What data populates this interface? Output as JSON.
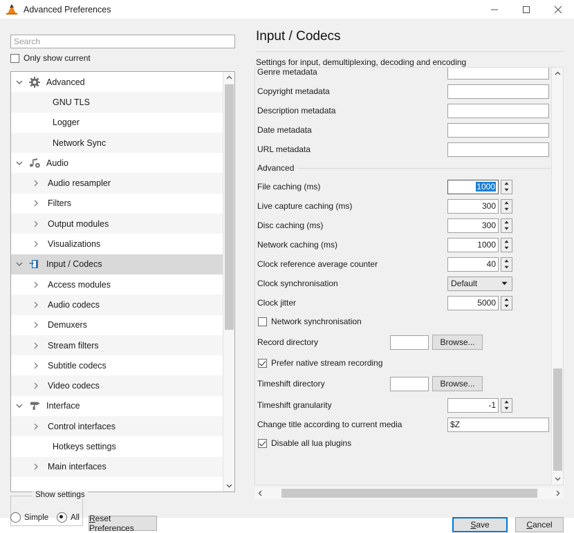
{
  "window": {
    "title": "Advanced Preferences",
    "app_icon": "vlc-cone-icon",
    "minimize": "minimize-icon",
    "maximize": "maximize-icon",
    "close": "close-icon"
  },
  "sidebar": {
    "search": {
      "value": "",
      "placeholder": "Search"
    },
    "only_show_current": {
      "label": "Only show current",
      "checked": false
    },
    "tree": [
      {
        "label": "Advanced",
        "level": 0,
        "expander": "down",
        "icon": "gear-icon",
        "alt": false,
        "selected": false
      },
      {
        "label": "GNU TLS",
        "level": 1,
        "expander": "none",
        "icon": "none",
        "alt": true,
        "selected": false
      },
      {
        "label": "Logger",
        "level": 1,
        "expander": "none",
        "icon": "none",
        "alt": false,
        "selected": false
      },
      {
        "label": "Network Sync",
        "level": 1,
        "expander": "none",
        "icon": "none",
        "alt": true,
        "selected": false
      },
      {
        "label": "Audio",
        "level": 0,
        "expander": "down",
        "icon": "audio-note-icon",
        "alt": false,
        "selected": false
      },
      {
        "label": "Audio resampler",
        "level": 1,
        "expander": "right",
        "icon": "none",
        "alt": true,
        "selected": false
      },
      {
        "label": "Filters",
        "level": 1,
        "expander": "right",
        "icon": "none",
        "alt": false,
        "selected": false
      },
      {
        "label": "Output modules",
        "level": 1,
        "expander": "right",
        "icon": "none",
        "alt": true,
        "selected": false
      },
      {
        "label": "Visualizations",
        "level": 1,
        "expander": "right",
        "icon": "none",
        "alt": false,
        "selected": false
      },
      {
        "label": "Input / Codecs",
        "level": 0,
        "expander": "down",
        "icon": "input-codecs-icon",
        "alt": false,
        "selected": true
      },
      {
        "label": "Access modules",
        "level": 1,
        "expander": "right",
        "icon": "none",
        "alt": false,
        "selected": false
      },
      {
        "label": "Audio codecs",
        "level": 1,
        "expander": "right",
        "icon": "none",
        "alt": true,
        "selected": false
      },
      {
        "label": "Demuxers",
        "level": 1,
        "expander": "right",
        "icon": "none",
        "alt": false,
        "selected": false
      },
      {
        "label": "Stream filters",
        "level": 1,
        "expander": "right",
        "icon": "none",
        "alt": true,
        "selected": false
      },
      {
        "label": "Subtitle codecs",
        "level": 1,
        "expander": "right",
        "icon": "none",
        "alt": false,
        "selected": false
      },
      {
        "label": "Video codecs",
        "level": 1,
        "expander": "right",
        "icon": "none",
        "alt": true,
        "selected": false
      },
      {
        "label": "Interface",
        "level": 0,
        "expander": "down",
        "icon": "paint-roller-icon",
        "alt": false,
        "selected": false
      },
      {
        "label": "Control interfaces",
        "level": 1,
        "expander": "right",
        "icon": "none",
        "alt": true,
        "selected": false
      },
      {
        "label": "Hotkeys settings",
        "level": 1,
        "expander": "none",
        "icon": "none",
        "alt": false,
        "selected": false
      },
      {
        "label": "Main interfaces",
        "level": 1,
        "expander": "right",
        "icon": "none",
        "alt": true,
        "selected": false
      }
    ]
  },
  "content": {
    "title": "Input / Codecs",
    "subtitle": "Settings for input, demultiplexing, decoding and encoding",
    "metadata_fields": [
      {
        "label": "Genre metadata",
        "value": ""
      },
      {
        "label": "Copyright metadata",
        "value": ""
      },
      {
        "label": "Description metadata",
        "value": ""
      },
      {
        "label": "Date metadata",
        "value": ""
      },
      {
        "label": "URL metadata",
        "value": ""
      }
    ],
    "advanced_section": "Advanced",
    "spin_fields": [
      {
        "label": "File caching (ms)",
        "value": "1000",
        "selected": true
      },
      {
        "label": "Live capture caching (ms)",
        "value": "300",
        "selected": false
      },
      {
        "label": "Disc caching (ms)",
        "value": "300",
        "selected": false
      },
      {
        "label": "Network caching (ms)",
        "value": "1000",
        "selected": false
      },
      {
        "label": "Clock reference average counter",
        "value": "40",
        "selected": false
      }
    ],
    "clock_sync": {
      "label": "Clock synchronisation",
      "value": "Default"
    },
    "clock_jitter": {
      "label": "Clock jitter",
      "value": "5000"
    },
    "network_sync": {
      "label": "Network synchronisation",
      "checked": false
    },
    "record_directory": {
      "label": "Record directory",
      "value": "",
      "browse": "Browse..."
    },
    "prefer_native": {
      "label": "Prefer native stream recording",
      "checked": true
    },
    "timeshift_directory": {
      "label": "Timeshift directory",
      "value": "",
      "browse": "Browse..."
    },
    "timeshift_granularity": {
      "label": "Timeshift granularity",
      "value": "-1"
    },
    "change_title": {
      "label": "Change title according to current media",
      "value": "$Z"
    },
    "disable_lua": {
      "label": "Disable all lua plugins",
      "checked": true
    }
  },
  "footer": {
    "show_settings_label": "Show settings",
    "simple_label": "Simple",
    "all_label": "All",
    "simple_selected": false,
    "all_selected": true,
    "reset_label": "Reset Preferences",
    "save_label": "Save",
    "cancel_label": "Cancel"
  },
  "colors": {
    "accent_focus": "#0078d7",
    "selection_blue": "#1a7fd4",
    "window_bg": "#f0f0f0",
    "tree_selected": "#d9d9d9"
  }
}
